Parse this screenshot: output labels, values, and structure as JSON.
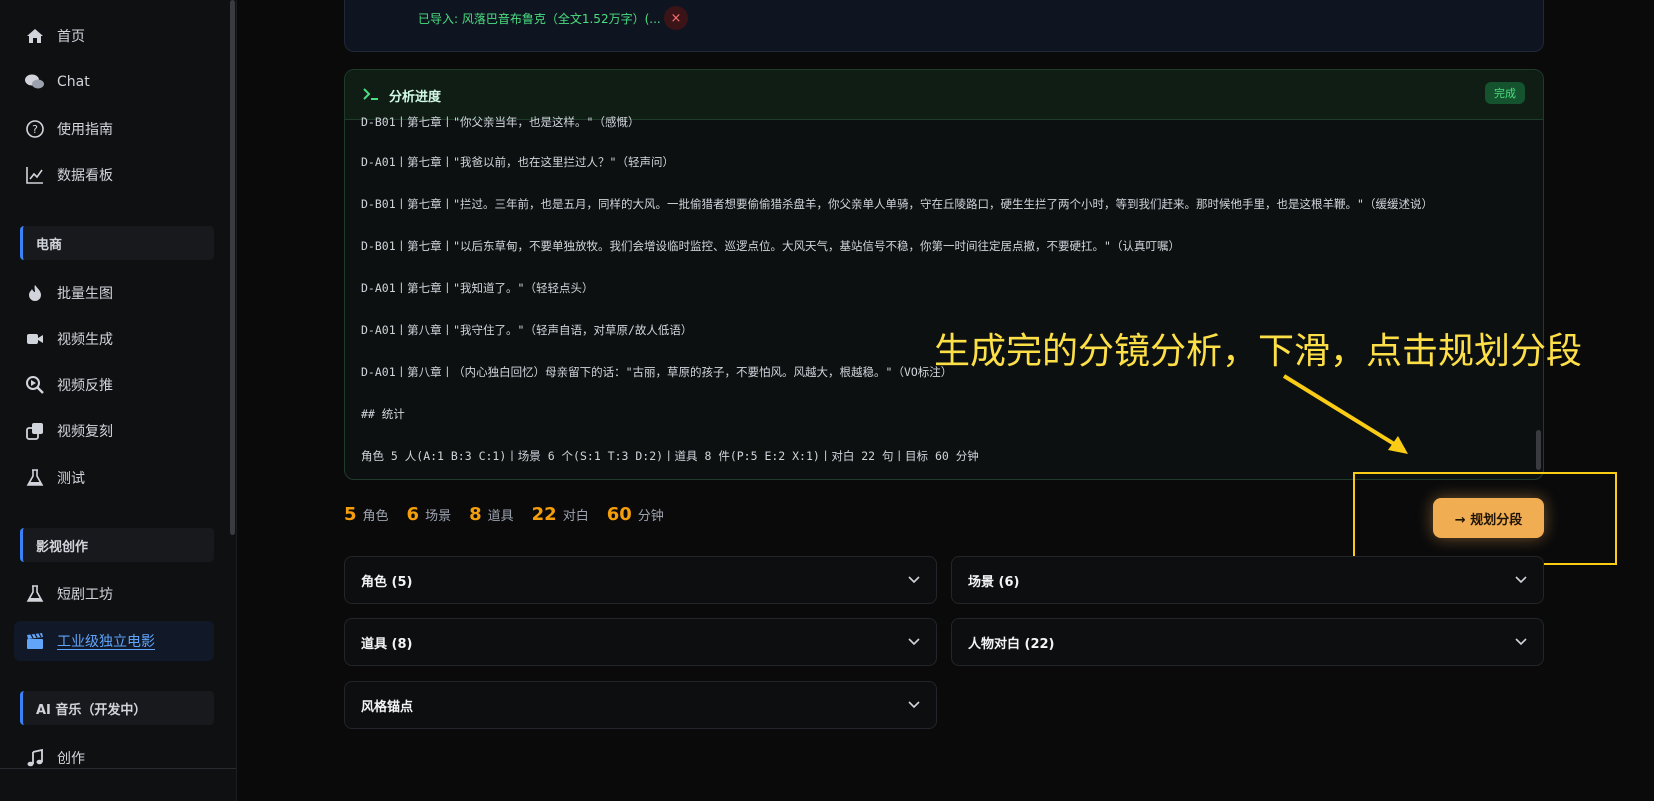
{
  "sidebar": {
    "items": [
      {
        "label": "首页",
        "icon": "home-icon"
      },
      {
        "label": "Chat",
        "icon": "chat-icon"
      },
      {
        "label": "使用指南",
        "icon": "help-icon"
      },
      {
        "label": "数据看板",
        "icon": "chart-icon"
      }
    ],
    "section_ecommerce": "电商",
    "ecommerce_items": [
      {
        "label": "批量生图",
        "icon": "fire-icon"
      },
      {
        "label": "视频生成",
        "icon": "video-icon"
      },
      {
        "label": "视频反推",
        "icon": "search-video-icon"
      },
      {
        "label": "视频复刻",
        "icon": "copy-icon"
      },
      {
        "label": "测试",
        "icon": "flask-icon"
      }
    ],
    "section_film": "影视创作",
    "film_items": [
      {
        "label": "短剧工坊",
        "icon": "flask-icon"
      },
      {
        "label": "工业级独立电影",
        "icon": "clapper-icon"
      }
    ],
    "section_music": "AI 音乐（开发中）",
    "music_items": [
      {
        "label": "创作",
        "icon": "music-icon"
      }
    ]
  },
  "import": {
    "text": "已导入: 风落巴音布鲁克（全文1.52万字）(...",
    "close": "×"
  },
  "analysis": {
    "title": "分析进度",
    "status": "完成",
    "lines": [
      "D-B01丨第七章丨\"你父亲当年，也是这样。\"（感慨）",
      "D-A01丨第七章丨\"我爸以前，也在这里拦过人？\"（轻声问）",
      "D-B01丨第七章丨\"拦过。三年前，也是五月，同样的大风。一批偷猎者想要偷偷猎杀盘羊，你父亲单人单骑，守在丘陵路口，硬生生拦了两个小时，等到我们赶来。那时候他手里，也是这根羊鞭。\"（缓缓述说）",
      "D-B01丨第七章丨\"以后东草甸，不要单独放牧。我们会增设临时监控、巡逻点位。大风天气，基站信号不稳，你第一时间往定居点撤，不要硬扛。\"（认真叮嘱）",
      "D-A01丨第七章丨\"我知道了。\"（轻轻点头）",
      "D-A01丨第八章丨\"我守住了。\"（轻声自语，对草原/故人低语）",
      "D-A01丨第八章丨（内心独白回忆）母亲留下的话：\"古丽，草原的孩子，不要怕风。风越大，根越稳。\"（VO标注）",
      "## 统计",
      "角色 5 人(A:1 B:3 C:1)丨场景 6 个(S:1 T:3 D:2)丨道具 8 件(P:5 E:2 X:1)丨对白 22 句丨目标 60 分钟"
    ]
  },
  "stats": [
    {
      "num": "5",
      "label": "角色"
    },
    {
      "num": "6",
      "label": "场景"
    },
    {
      "num": "8",
      "label": "道具"
    },
    {
      "num": "22",
      "label": "对白"
    },
    {
      "num": "60",
      "label": "分钟"
    }
  ],
  "plan_button": "→  规划分段",
  "annotation": "生成完的分镜分析，下滑，点击规划分段",
  "panels": {
    "roles": "角色 (5)",
    "scenes": "场景 (6)",
    "props": "道具 (8)",
    "dialogue": "人物对白 (22)",
    "style": "风格锚点"
  },
  "colors": {
    "accent": "#3b82f6",
    "stat": "#f59e0b",
    "button": "#f0ad52",
    "annotation": "#fde047",
    "success": "#4ade80"
  }
}
